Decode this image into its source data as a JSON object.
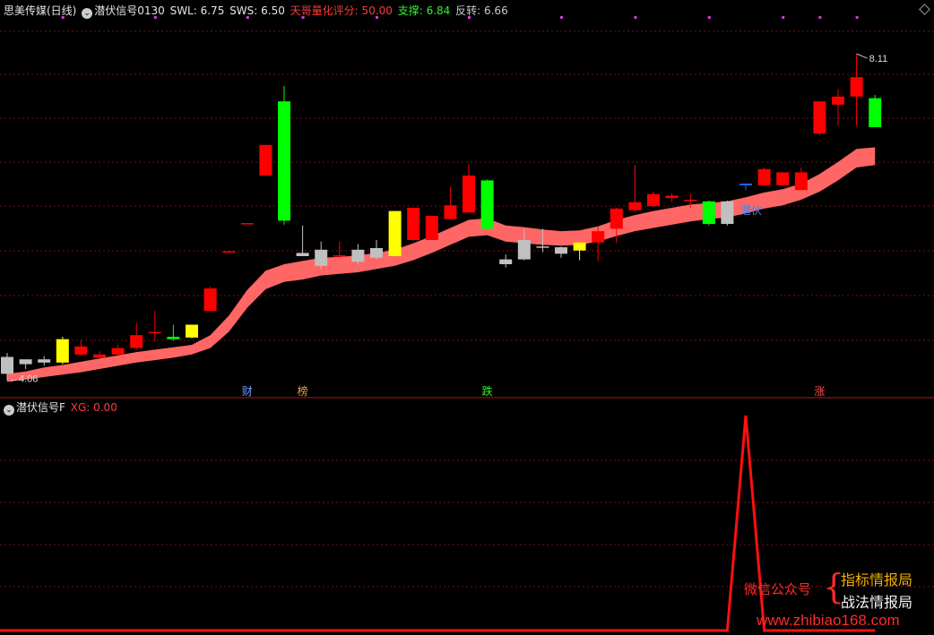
{
  "header_main": {
    "stock": "思美传媒(日线)",
    "indicator": "潜伏信号0130",
    "swl": "SWL: 6.75",
    "sws": "SWS: 6.50",
    "score": "天哥量化评分: 50.00",
    "support": "支撑: 6.84",
    "reversal": "反转: 6.66"
  },
  "header_sub": {
    "indicator": "潜伏信号F",
    "xg": "XG: 0.00"
  },
  "watermark": {
    "wechat": "微信公众号",
    "line1": "指标情报局",
    "line2": "战法情报局",
    "url": "www.zhibiao168.com"
  },
  "colors": {
    "up": "#ff0000",
    "down_special": "#00ff00",
    "neutral": "#c0c0c0",
    "yellow": "#ffff00",
    "blue": "#1e6fff",
    "band": "#ff6666",
    "signal_line": "#ff1010",
    "grid": "#7a1010"
  },
  "chart_data": {
    "type": "candlestick",
    "price_range": [
      4.0,
      8.5
    ],
    "max_label": "8.11",
    "min_label": "4.06",
    "candles": [
      {
        "o": 4.35,
        "h": 4.4,
        "l": 4.06,
        "c": 4.14,
        "color": "gray"
      },
      {
        "o": 4.26,
        "h": 4.3,
        "l": 4.2,
        "c": 4.32,
        "color": "gray"
      },
      {
        "o": 4.28,
        "h": 4.36,
        "l": 4.24,
        "c": 4.32,
        "color": "gray"
      },
      {
        "o": 4.28,
        "h": 4.6,
        "l": 4.26,
        "c": 4.57,
        "color": "yellow"
      },
      {
        "o": 4.38,
        "h": 4.56,
        "l": 4.36,
        "c": 4.48,
        "color": "red"
      },
      {
        "o": 4.34,
        "h": 4.42,
        "l": 4.32,
        "c": 4.38,
        "color": "red"
      },
      {
        "o": 4.38,
        "h": 4.5,
        "l": 4.36,
        "c": 4.46,
        "color": "red"
      },
      {
        "o": 4.46,
        "h": 4.77,
        "l": 4.44,
        "c": 4.62,
        "color": "red"
      },
      {
        "o": 4.65,
        "h": 4.92,
        "l": 4.55,
        "c": 4.66,
        "color": "red"
      },
      {
        "o": 4.57,
        "h": 4.75,
        "l": 4.55,
        "c": 4.6,
        "color": "green"
      },
      {
        "o": 4.59,
        "h": 4.75,
        "l": 4.58,
        "c": 4.75,
        "color": "yellow"
      },
      {
        "o": 4.92,
        "h": 5.22,
        "l": 4.92,
        "c": 5.2,
        "color": "red"
      },
      {
        "o": 5.65,
        "h": 5.66,
        "l": 5.65,
        "c": 5.66,
        "color": "red"
      },
      {
        "o": 6.0,
        "h": 6.01,
        "l": 6.0,
        "c": 6.01,
        "color": "red"
      },
      {
        "o": 6.6,
        "h": 6.98,
        "l": 6.6,
        "c": 6.98,
        "color": "red"
      },
      {
        "o": 7.52,
        "h": 7.71,
        "l": 5.99,
        "c": 6.04,
        "color": "green"
      },
      {
        "o": 5.6,
        "h": 5.98,
        "l": 5.6,
        "c": 5.64,
        "color": "gray"
      },
      {
        "o": 5.48,
        "h": 5.78,
        "l": 5.44,
        "c": 5.68,
        "color": "gray"
      },
      {
        "o": 5.6,
        "h": 5.78,
        "l": 5.58,
        "c": 5.61,
        "color": "red"
      },
      {
        "o": 5.53,
        "h": 5.75,
        "l": 5.5,
        "c": 5.68,
        "color": "gray"
      },
      {
        "o": 5.58,
        "h": 5.8,
        "l": 5.56,
        "c": 5.7,
        "color": "gray"
      },
      {
        "o": 5.6,
        "h": 6.16,
        "l": 5.6,
        "c": 6.16,
        "color": "yellow"
      },
      {
        "o": 5.8,
        "h": 6.2,
        "l": 5.78,
        "c": 6.2,
        "color": "red"
      },
      {
        "o": 5.8,
        "h": 6.1,
        "l": 5.8,
        "c": 6.1,
        "color": "red"
      },
      {
        "o": 6.06,
        "h": 6.46,
        "l": 6.05,
        "c": 6.23,
        "color": "red"
      },
      {
        "o": 6.14,
        "h": 6.74,
        "l": 6.14,
        "c": 6.6,
        "color": "red"
      },
      {
        "o": 6.54,
        "h": 6.55,
        "l": 5.92,
        "c": 5.94,
        "color": "green"
      },
      {
        "o": 5.5,
        "h": 5.62,
        "l": 5.46,
        "c": 5.56,
        "color": "gray"
      },
      {
        "o": 5.56,
        "h": 5.94,
        "l": 5.55,
        "c": 5.8,
        "color": "gray"
      },
      {
        "o": 5.72,
        "h": 5.94,
        "l": 5.65,
        "c": 5.72,
        "color": "gray"
      },
      {
        "o": 5.63,
        "h": 5.72,
        "l": 5.58,
        "c": 5.71,
        "color": "gray"
      },
      {
        "o": 5.67,
        "h": 5.77,
        "l": 5.55,
        "c": 5.77,
        "color": "yellow"
      },
      {
        "o": 5.77,
        "h": 5.96,
        "l": 5.54,
        "c": 5.91,
        "color": "red"
      },
      {
        "o": 5.94,
        "h": 6.2,
        "l": 5.76,
        "c": 6.19,
        "color": "red"
      },
      {
        "o": 6.17,
        "h": 6.73,
        "l": 6.15,
        "c": 6.27,
        "color": "red"
      },
      {
        "o": 6.22,
        "h": 6.4,
        "l": 6.21,
        "c": 6.37,
        "color": "red"
      },
      {
        "o": 6.32,
        "h": 6.38,
        "l": 6.27,
        "c": 6.35,
        "color": "red"
      },
      {
        "o": 6.3,
        "h": 6.37,
        "l": 6.2,
        "c": 6.3,
        "color": "red"
      },
      {
        "o": 6.28,
        "h": 6.29,
        "l": 5.98,
        "c": 6.0,
        "color": "green"
      },
      {
        "o": 6.0,
        "h": 6.29,
        "l": 5.98,
        "c": 6.28,
        "color": "gray"
      },
      {
        "o": 6.48,
        "h": 6.5,
        "l": 6.42,
        "c": 6.5,
        "color": "blue"
      },
      {
        "o": 6.48,
        "h": 6.7,
        "l": 6.47,
        "c": 6.68,
        "color": "red"
      },
      {
        "o": 6.48,
        "h": 6.64,
        "l": 6.47,
        "c": 6.64,
        "color": "red"
      },
      {
        "o": 6.42,
        "h": 6.7,
        "l": 6.42,
        "c": 6.64,
        "color": "red"
      },
      {
        "o": 7.12,
        "h": 7.52,
        "l": 7.1,
        "c": 7.52,
        "color": "red"
      },
      {
        "o": 7.48,
        "h": 7.67,
        "l": 7.22,
        "c": 7.58,
        "color": "red"
      },
      {
        "o": 7.58,
        "h": 8.11,
        "l": 7.22,
        "c": 7.82,
        "color": "red"
      },
      {
        "o": 7.56,
        "h": 7.6,
        "l": 7.2,
        "c": 7.2,
        "color": "green"
      }
    ],
    "band_upper": [
      4.14,
      4.17,
      4.22,
      4.25,
      4.29,
      4.33,
      4.37,
      4.41,
      4.44,
      4.47,
      4.5,
      4.62,
      4.86,
      5.18,
      5.42,
      5.5,
      5.54,
      5.58,
      5.59,
      5.61,
      5.64,
      5.68,
      5.76,
      5.85,
      5.95,
      6.05,
      6.07,
      5.98,
      5.96,
      5.93,
      5.91,
      5.92,
      5.97,
      6.05,
      6.11,
      6.16,
      6.2,
      6.24,
      6.26,
      6.28,
      6.33,
      6.39,
      6.43,
      6.5,
      6.62,
      6.77,
      6.93,
      6.95
    ],
    "band_lower": [
      4.04,
      4.07,
      4.1,
      4.13,
      4.16,
      4.2,
      4.24,
      4.28,
      4.31,
      4.34,
      4.38,
      4.46,
      4.66,
      4.96,
      5.19,
      5.28,
      5.31,
      5.36,
      5.38,
      5.4,
      5.44,
      5.48,
      5.55,
      5.64,
      5.74,
      5.84,
      5.86,
      5.78,
      5.76,
      5.74,
      5.73,
      5.74,
      5.78,
      5.85,
      5.91,
      5.95,
      5.99,
      6.03,
      6.06,
      6.08,
      6.13,
      6.19,
      6.23,
      6.3,
      6.4,
      6.54,
      6.7,
      6.73
    ],
    "price_marks": [
      {
        "index": 13,
        "text": "财",
        "color": "#6aa0ff"
      },
      {
        "index": 16,
        "text": "榜",
        "color": "#e2a050"
      },
      {
        "index": 26,
        "text": "跌",
        "color": "#2ef52e"
      },
      {
        "index": 44,
        "text": "涨",
        "color": "#ff5050"
      }
    ],
    "signal_label": {
      "index": 40,
      "text": "潜伏",
      "color": "#2f8dff"
    },
    "top_dots": [
      3,
      8,
      13,
      16,
      20,
      25,
      30,
      34,
      38,
      42,
      44,
      46
    ],
    "xg_series": [
      0,
      0,
      0,
      0,
      0,
      0,
      0,
      0,
      0,
      0,
      0,
      0,
      0,
      0,
      0,
      0,
      0,
      0,
      0,
      0,
      0,
      0,
      0,
      0,
      0,
      0,
      0,
      0,
      0,
      0,
      0,
      0,
      0,
      0,
      0,
      0,
      0,
      0,
      0,
      0,
      1,
      0,
      0,
      0,
      0,
      0,
      0,
      0
    ],
    "xg_range": [
      0,
      1
    ]
  }
}
